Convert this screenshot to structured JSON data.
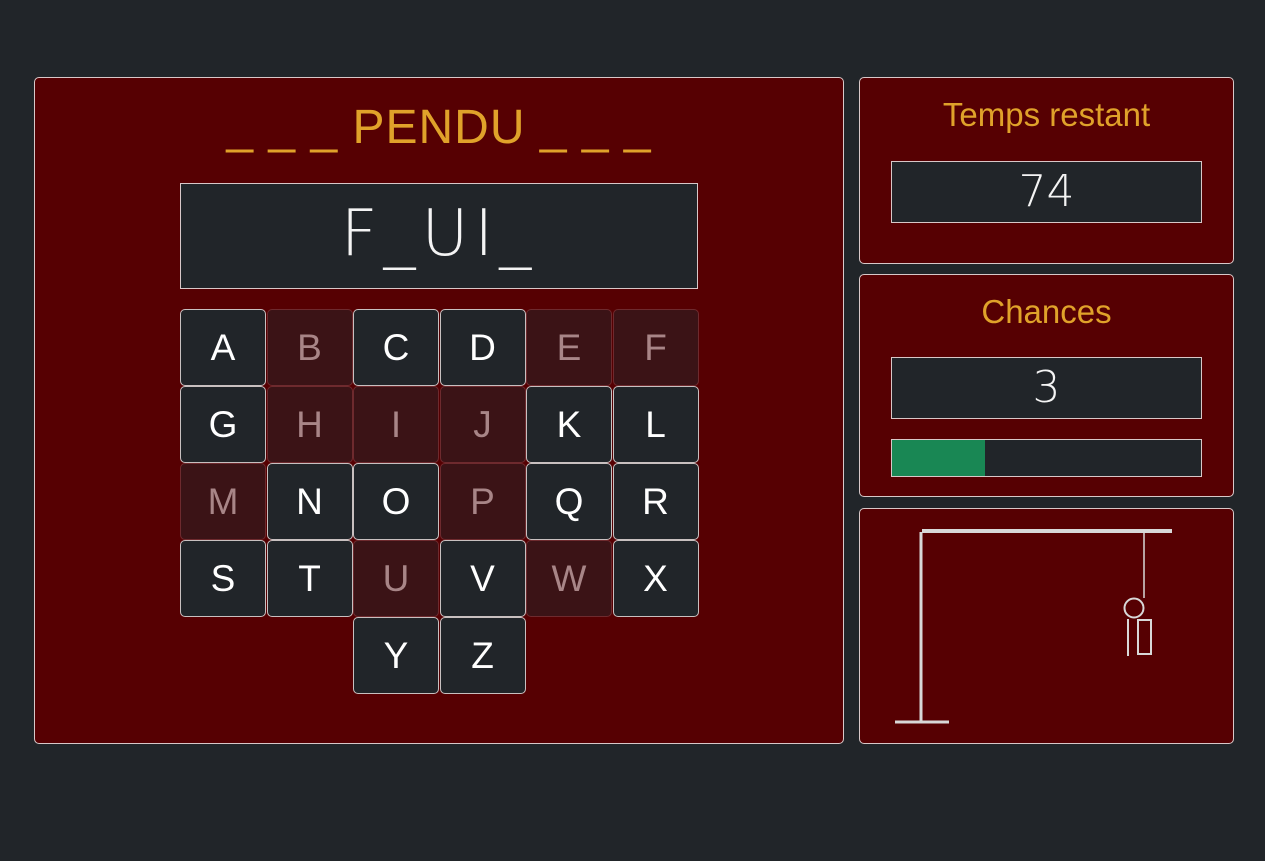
{
  "game": {
    "title": "_ _ _ PENDU _ _ _",
    "masked_word": "F_UI_"
  },
  "keyboard": {
    "keys": [
      {
        "letter": "A",
        "used": false
      },
      {
        "letter": "B",
        "used": true
      },
      {
        "letter": "C",
        "used": false
      },
      {
        "letter": "D",
        "used": false
      },
      {
        "letter": "E",
        "used": true
      },
      {
        "letter": "F",
        "used": true
      },
      {
        "letter": "G",
        "used": false
      },
      {
        "letter": "H",
        "used": true
      },
      {
        "letter": "I",
        "used": true
      },
      {
        "letter": "J",
        "used": true
      },
      {
        "letter": "K",
        "used": false
      },
      {
        "letter": "L",
        "used": false
      },
      {
        "letter": "M",
        "used": true
      },
      {
        "letter": "N",
        "used": false
      },
      {
        "letter": "O",
        "used": false
      },
      {
        "letter": "P",
        "used": true
      },
      {
        "letter": "Q",
        "used": false
      },
      {
        "letter": "R",
        "used": false
      },
      {
        "letter": "S",
        "used": false
      },
      {
        "letter": "T",
        "used": false
      },
      {
        "letter": "U",
        "used": true
      },
      {
        "letter": "V",
        "used": false
      },
      {
        "letter": "W",
        "used": true
      },
      {
        "letter": "X",
        "used": false
      },
      {
        "letter": "Y",
        "used": false
      },
      {
        "letter": "Z",
        "used": false
      }
    ]
  },
  "time": {
    "label": "Temps restant",
    "value": "74"
  },
  "chances": {
    "label": "Chances",
    "value": "3",
    "progress_fraction": 0.3
  },
  "colors": {
    "panel_bg": "#560002",
    "page_bg": "#212529",
    "accent": "#e0a22a",
    "progress": "#198754"
  }
}
